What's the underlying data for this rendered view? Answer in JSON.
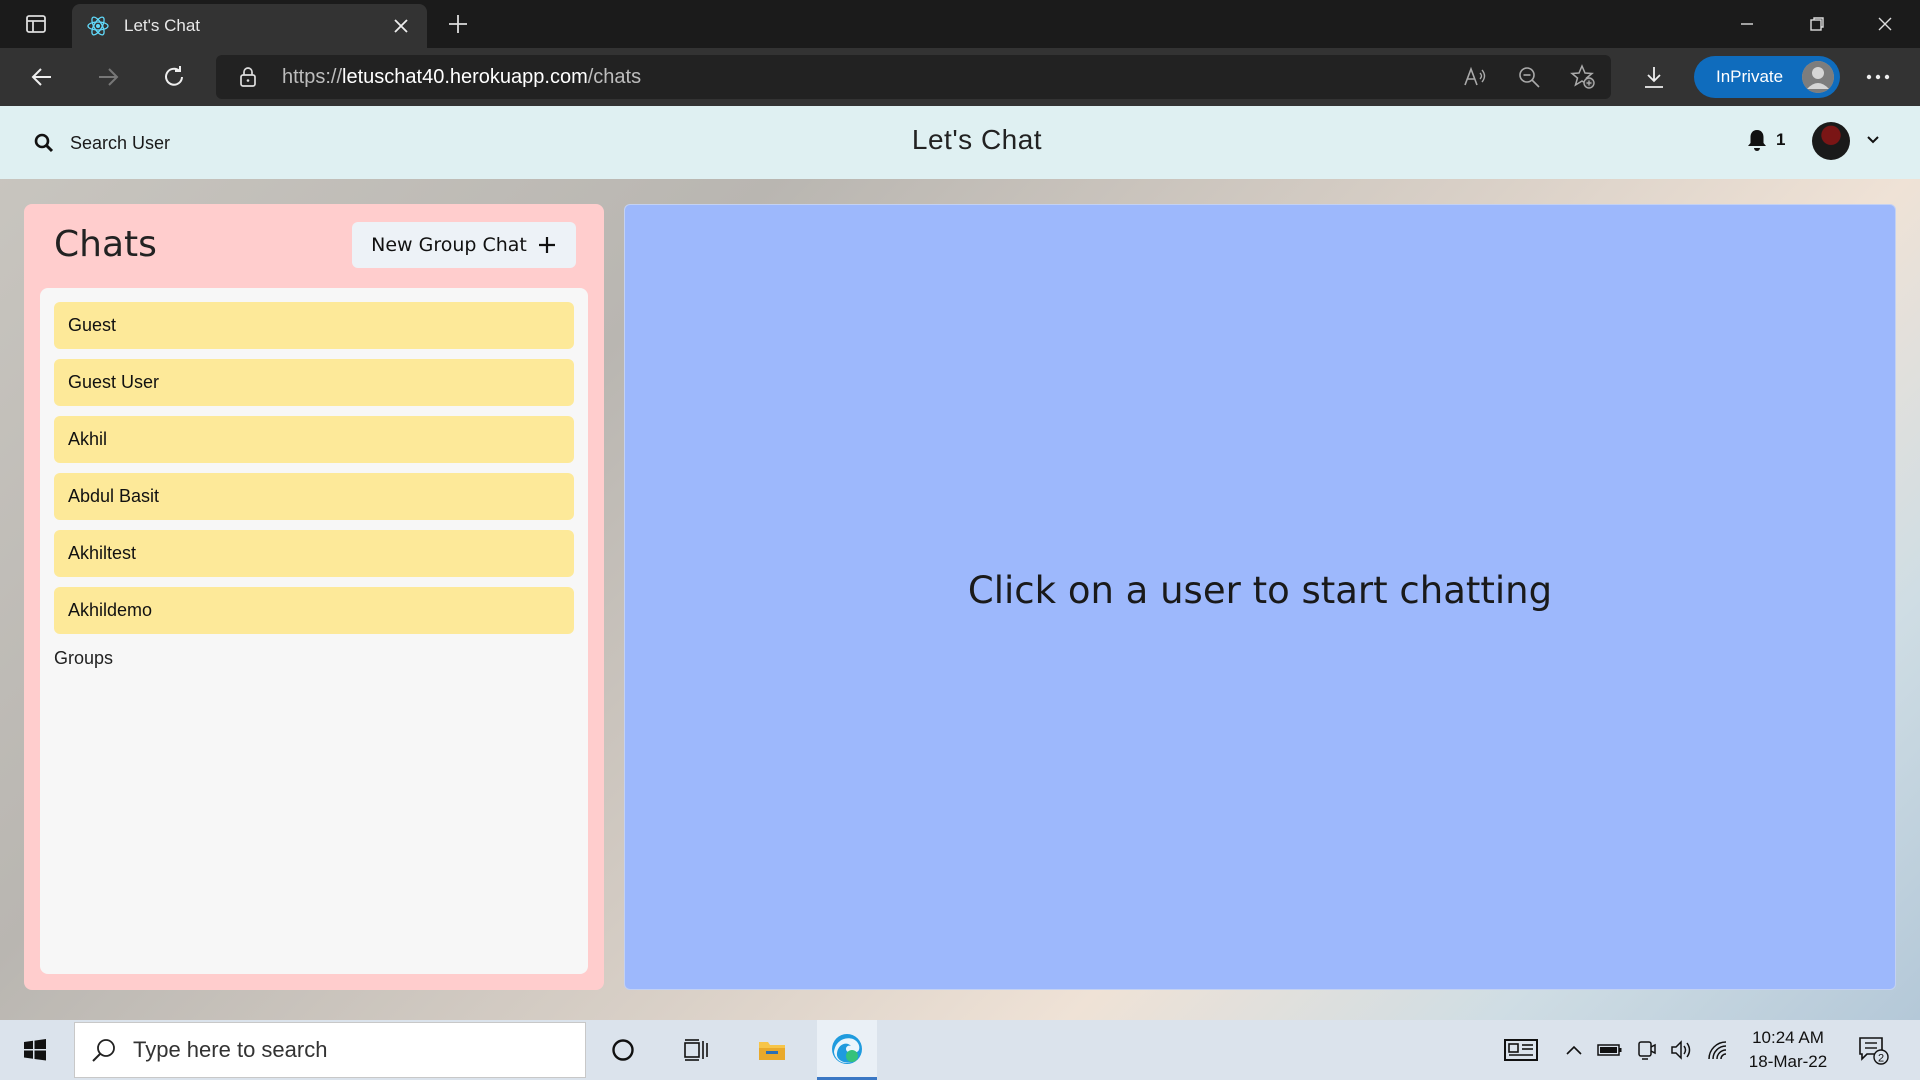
{
  "browser": {
    "tab_title": "Let's Chat",
    "url_prefix": "https://",
    "url_host": "letuschat40.herokuapp.com",
    "url_path": "/chats",
    "inprivate_label": "InPrivate"
  },
  "header": {
    "search_label": "Search User",
    "app_title": "Let's Chat",
    "notification_count": "1"
  },
  "chats": {
    "heading": "Chats",
    "new_group_label": "New Group Chat",
    "items": [
      {
        "name": "Guest"
      },
      {
        "name": "Guest User"
      },
      {
        "name": "Akhil"
      },
      {
        "name": "Abdul Basit"
      },
      {
        "name": "Akhiltest"
      },
      {
        "name": "Akhildemo"
      }
    ],
    "groups_label": "Groups"
  },
  "chatbox": {
    "placeholder": "Click on a user to start chatting"
  },
  "taskbar": {
    "search_placeholder": "Type here to search",
    "time": "10:24 AM",
    "date": "18-Mar-22",
    "notifications_badge": "2"
  },
  "colors": {
    "chats_panel_bg": "#ffcdcd",
    "chat_item_bg": "#fde999",
    "chatbox_bg": "#9db8fc",
    "appbar_bg": "#dff0f2",
    "inprivate_bg": "#0f6cbd"
  }
}
